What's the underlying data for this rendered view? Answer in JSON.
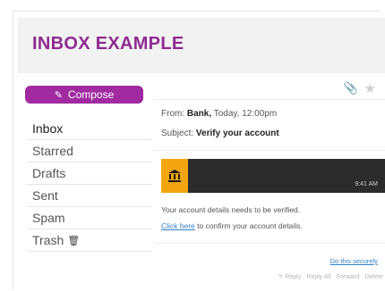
{
  "header": {
    "title": "INBOX EXAMPLE"
  },
  "sidebar": {
    "compose_label": "Compose",
    "items": [
      {
        "label": "Inbox"
      },
      {
        "label": "Starred"
      },
      {
        "label": "Drafts"
      },
      {
        "label": "Sent"
      },
      {
        "label": "Spam"
      },
      {
        "label": "Trash"
      }
    ]
  },
  "message": {
    "from_prefix": "From:",
    "from_name": "Bank,",
    "from_when": "Today, 12:00pm",
    "subject_prefix": "Subject:",
    "subject": "Verify your account",
    "banner_text": "9:41 AM",
    "body_line1": "Your account details needs to be verified.",
    "link_text": "Click here",
    "body_line2_rest": " to confirm your account details.",
    "report_link": "Do this securely",
    "actions_text": "↰ Reply · Reply All · Forward · Delete"
  },
  "colors": {
    "accent": "#8e2a8f",
    "compose_bg": "#a02aa0",
    "bank_orange": "#f3a611",
    "link_blue": "#2f7fc8"
  },
  "icons": [
    "pencil-icon",
    "trash-icon",
    "paperclip-icon",
    "star-icon",
    "bank-icon"
  ]
}
